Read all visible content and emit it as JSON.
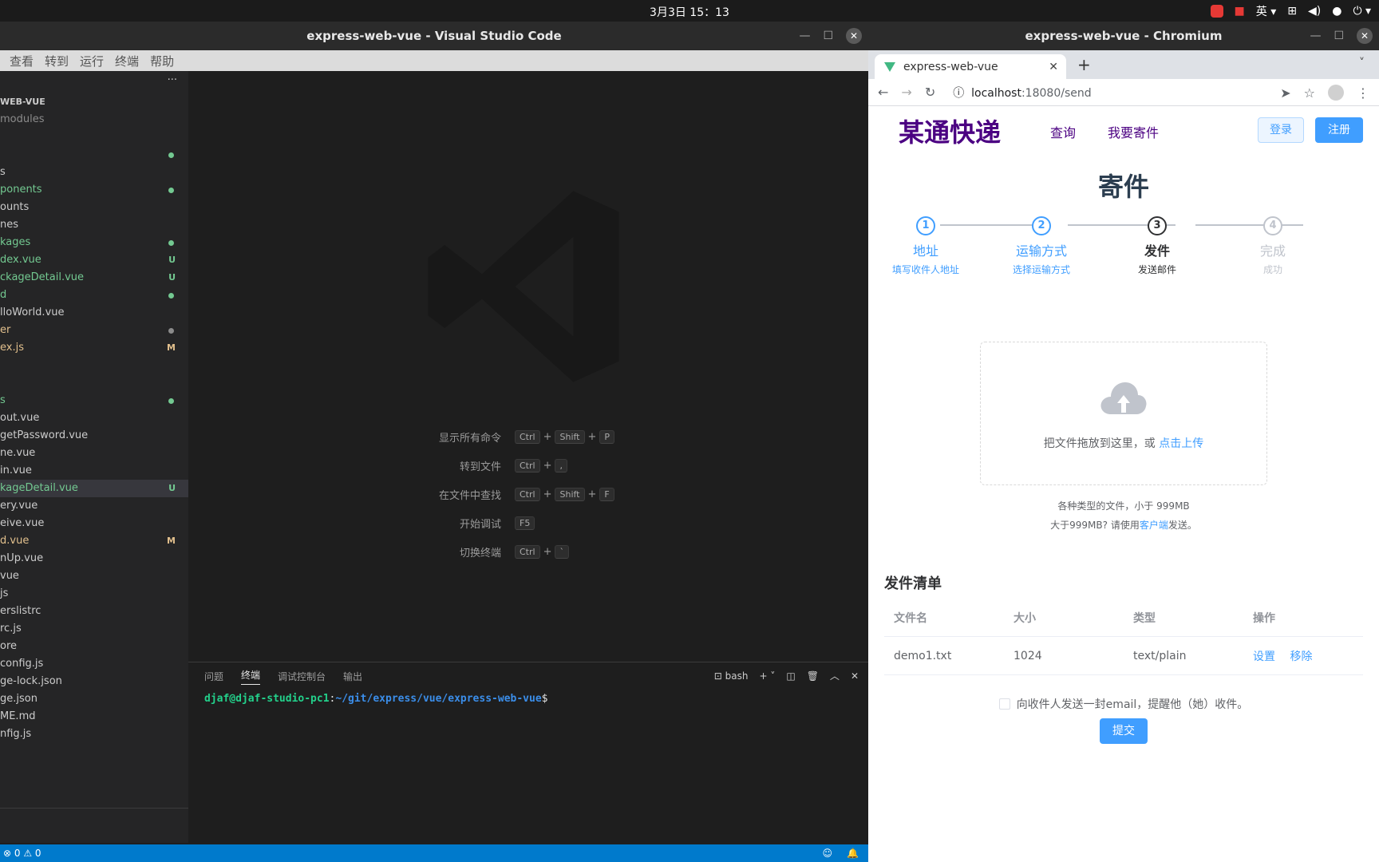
{
  "topbar": {
    "clock": "3月3日  15：13",
    "input_method": "英"
  },
  "vscode": {
    "title": "express-web-vue - Visual Studio Code",
    "menu": [
      "查看",
      "转到",
      "运行",
      "终端",
      "帮助"
    ],
    "explorer_header": "WEB-VUE",
    "files": [
      {
        "name": "modules",
        "color": "gray",
        "mark": ""
      },
      {
        "name": "",
        "color": "white",
        "mark": ""
      },
      {
        "name": "",
        "color": "green",
        "mark": "dot"
      },
      {
        "name": "s",
        "color": "white",
        "mark": ""
      },
      {
        "name": "ponents",
        "color": "green",
        "mark": "dot"
      },
      {
        "name": "ounts",
        "color": "white",
        "mark": ""
      },
      {
        "name": "nes",
        "color": "white",
        "mark": ""
      },
      {
        "name": "kages",
        "color": "green",
        "mark": "dot"
      },
      {
        "name": "dex.vue",
        "color": "green",
        "mark": "U"
      },
      {
        "name": "ckageDetail.vue",
        "color": "green",
        "mark": "U"
      },
      {
        "name": "d",
        "color": "green",
        "mark": "dot"
      },
      {
        "name": "lloWorld.vue",
        "color": "white",
        "mark": ""
      },
      {
        "name": "er",
        "color": "yellow",
        "mark": "dotgray"
      },
      {
        "name": "ex.js",
        "color": "yellow",
        "mark": "M"
      },
      {
        "name": "",
        "color": "white",
        "mark": ""
      },
      {
        "name": "",
        "color": "white",
        "mark": ""
      },
      {
        "name": "s",
        "color": "green",
        "mark": "dot"
      },
      {
        "name": "out.vue",
        "color": "white",
        "mark": ""
      },
      {
        "name": "getPassword.vue",
        "color": "white",
        "mark": ""
      },
      {
        "name": "ne.vue",
        "color": "white",
        "mark": ""
      },
      {
        "name": "in.vue",
        "color": "white",
        "mark": ""
      },
      {
        "name": "kageDetail.vue",
        "color": "green",
        "mark": "U",
        "selected": true
      },
      {
        "name": "ery.vue",
        "color": "white",
        "mark": ""
      },
      {
        "name": "eive.vue",
        "color": "white",
        "mark": ""
      },
      {
        "name": "d.vue",
        "color": "yellow",
        "mark": "M"
      },
      {
        "name": "nUp.vue",
        "color": "white",
        "mark": ""
      },
      {
        "name": "vue",
        "color": "white",
        "mark": ""
      },
      {
        "name": "js",
        "color": "white",
        "mark": ""
      },
      {
        "name": "erslistrc",
        "color": "white",
        "mark": ""
      },
      {
        "name": "rc.js",
        "color": "white",
        "mark": ""
      },
      {
        "name": "ore",
        "color": "white",
        "mark": ""
      },
      {
        "name": "config.js",
        "color": "white",
        "mark": ""
      },
      {
        "name": "ge-lock.json",
        "color": "white",
        "mark": ""
      },
      {
        "name": "ge.json",
        "color": "white",
        "mark": ""
      },
      {
        "name": "ME.md",
        "color": "white",
        "mark": ""
      },
      {
        "name": "nfig.js",
        "color": "white",
        "mark": ""
      }
    ],
    "shortcuts": [
      {
        "label": "显示所有命令",
        "keys": [
          "Ctrl",
          "+",
          "Shift",
          "+",
          "P"
        ]
      },
      {
        "label": "转到文件",
        "keys": [
          "Ctrl",
          "+",
          ","
        ]
      },
      {
        "label": "在文件中查找",
        "keys": [
          "Ctrl",
          "+",
          "Shift",
          "+",
          "F"
        ]
      },
      {
        "label": "开始调试",
        "keys": [
          "F5"
        ]
      },
      {
        "label": "切换终端",
        "keys": [
          "Ctrl",
          "+",
          "`"
        ]
      }
    ],
    "panel_tabs": [
      "问题",
      "终端",
      "调试控制台",
      "输出"
    ],
    "panel_active": "终端",
    "shell": "bash",
    "terminal": {
      "user": "djaf@djaf-studio-pc1",
      "path": "~/git/express/vue/express-web-vue",
      "prompt": "$"
    },
    "status": {
      "errors": "0",
      "warnings": "0"
    }
  },
  "chromium": {
    "title": "express-web-vue - Chromium",
    "tab_title": "express-web-vue",
    "url_host": "localhost",
    "url_rest": ":18080/send"
  },
  "site": {
    "logo": "某通快递",
    "nav": [
      "查询",
      "我要寄件"
    ],
    "login": "登录",
    "register": "注册",
    "page_title": "寄件",
    "steps": [
      {
        "num": "1",
        "title": "地址",
        "desc": "填写收件人地址",
        "state": "done"
      },
      {
        "num": "2",
        "title": "运输方式",
        "desc": "选择运输方式",
        "state": "done"
      },
      {
        "num": "3",
        "title": "发件",
        "desc": "发送邮件",
        "state": "active"
      },
      {
        "num": "4",
        "title": "完成",
        "desc": "成功",
        "state": "wait"
      }
    ],
    "upload": {
      "text": "把文件拖放到这里，或 ",
      "link": "点击上传"
    },
    "tip1": "各种类型的文件，小于 999MB",
    "tip2": {
      "before": "大于999MB? 请使用",
      "link": "客户端",
      "after": "发送。"
    },
    "list_title": "发件清单",
    "table": {
      "headers": [
        "文件名",
        "大小",
        "类型",
        "操作"
      ],
      "rows": [
        {
          "name": "demo1.txt",
          "size": "1024",
          "type": "text/plain",
          "ops": [
            "设置",
            "移除"
          ]
        }
      ]
    },
    "notify_label": "向收件人发送一封email，提醒他（她）收件。",
    "submit": "提交"
  },
  "colors": {
    "accent": "#409eff",
    "brand": "#4b0082",
    "statusbar": "#007acc"
  }
}
